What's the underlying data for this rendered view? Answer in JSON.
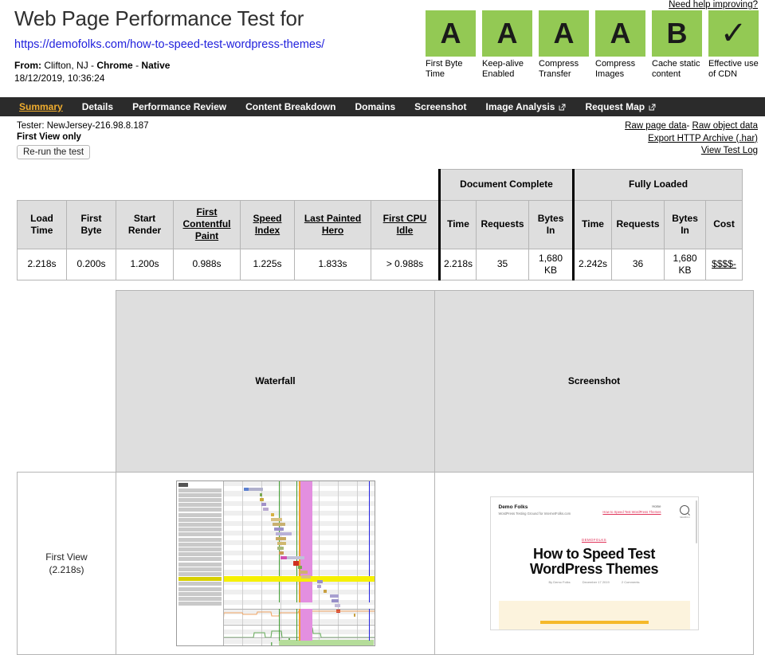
{
  "header": {
    "title": "Web Page Performance Test for",
    "url": "https://demofolks.com/how-to-speed-test-wordpress-themes/",
    "from_label": "From:",
    "from_value": "Clifton, NJ -",
    "browser": "Chrome",
    "dash": "-",
    "connection": "Native",
    "datetime": "18/12/2019, 10:36:24",
    "need_help": "Need help improving?"
  },
  "grades": [
    {
      "grade": "A",
      "label": "First Byte Time",
      "color": "#93c954",
      "icon": "letter-grade"
    },
    {
      "grade": "A",
      "label": "Keep-alive Enabled",
      "color": "#93c954",
      "icon": "letter-grade"
    },
    {
      "grade": "A",
      "label": "Compress Transfer",
      "color": "#93c954",
      "icon": "letter-grade"
    },
    {
      "grade": "A",
      "label": "Compress Images",
      "color": "#93c954",
      "icon": "letter-grade"
    },
    {
      "grade": "B",
      "label": "Cache static content",
      "color": "#93c954",
      "icon": "letter-grade"
    },
    {
      "grade": "✓",
      "label": "Effective use of CDN",
      "color": "#93c954",
      "icon": "checkmark-icon"
    }
  ],
  "nav": {
    "active": "Summary",
    "items": [
      {
        "label": "Summary",
        "external": false,
        "active": true
      },
      {
        "label": "Details",
        "external": false,
        "active": false
      },
      {
        "label": "Performance Review",
        "external": false,
        "active": false
      },
      {
        "label": "Content Breakdown",
        "external": false,
        "active": false
      },
      {
        "label": "Domains",
        "external": false,
        "active": false
      },
      {
        "label": "Screenshot",
        "external": false,
        "active": false
      },
      {
        "label": "Image Analysis",
        "external": true,
        "active": false
      },
      {
        "label": "Request Map",
        "external": true,
        "active": false
      }
    ]
  },
  "info": {
    "tester": "Tester: NewJersey-216.98.8.187",
    "view": "First View only",
    "rerun_button": "Re-run the test",
    "links": {
      "raw_page_data": "Raw page data",
      "separator": "-",
      "raw_object_data": "Raw object data",
      "export_har": "Export HTTP Archive (.har)",
      "view_test_log": "View Test Log"
    }
  },
  "results": {
    "group_headers": {
      "document_complete": "Document Complete",
      "fully_loaded": "Fully Loaded"
    },
    "columns": [
      {
        "label": "Load Time",
        "underline": false
      },
      {
        "label": "First Byte",
        "underline": false
      },
      {
        "label": "Start Render",
        "underline": false
      },
      {
        "label": "First Contentful Paint",
        "underline": true
      },
      {
        "label": "Speed Index",
        "underline": true
      },
      {
        "label": "Last Painted Hero",
        "underline": true
      },
      {
        "label": "First CPU Idle",
        "underline": true
      },
      {
        "label": "Time",
        "underline": false
      },
      {
        "label": "Requests",
        "underline": false
      },
      {
        "label": "Bytes In",
        "underline": false
      },
      {
        "label": "Time",
        "underline": false
      },
      {
        "label": "Requests",
        "underline": false
      },
      {
        "label": "Bytes In",
        "underline": false
      },
      {
        "label": "Cost",
        "underline": false
      }
    ],
    "row": [
      "2.218s",
      "0.200s",
      "1.200s",
      "0.988s",
      "1.225s",
      "1.833s",
      "> 0.988s",
      "2.218s",
      "35",
      "1,680 KB",
      "2.242s",
      "36",
      "1,680 KB",
      "$$$$-"
    ]
  },
  "waterfall_section": {
    "col_waterfall": "Waterfall",
    "col_screenshot": "Screenshot",
    "view_label_line1": "First View",
    "view_label_line2": "(2.218s)"
  },
  "screenshot_thumb": {
    "brand": "Demo Folks",
    "tagline": "WordPress Testing Ground for InternetFolks.com",
    "nav_home": "Home",
    "nav_article": "How to Speed Test WordPress Themes",
    "search_label": "SEARCH",
    "category": "DEMOFOLKS",
    "headline": "How to Speed Test WordPress Themes",
    "meta_author": "By Demo Folks",
    "meta_date": "December 17 2019",
    "meta_comments": "2 Comments"
  }
}
